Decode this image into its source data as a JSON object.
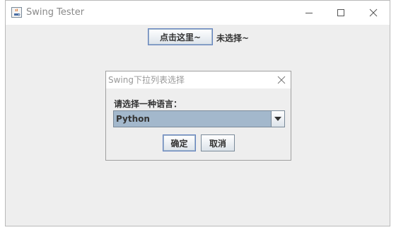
{
  "window": {
    "title": "Swing Tester",
    "icon": "java-coffee-icon",
    "controls": {
      "minimize": "minimize-icon",
      "maximize": "maximize-icon",
      "close": "close-icon"
    }
  },
  "main": {
    "click_button_label": "点击这里~",
    "status_label": "未选择~"
  },
  "dialog": {
    "title": "Swing下拉列表选择",
    "prompt": "请选择一种语言：",
    "combo_selected": "Python",
    "ok_label": "确定",
    "cancel_label": "取消"
  },
  "colors": {
    "panel_bg": "#eeeeee",
    "combo_selection": "#a3b8cc",
    "button_border": "#7a8a99"
  }
}
